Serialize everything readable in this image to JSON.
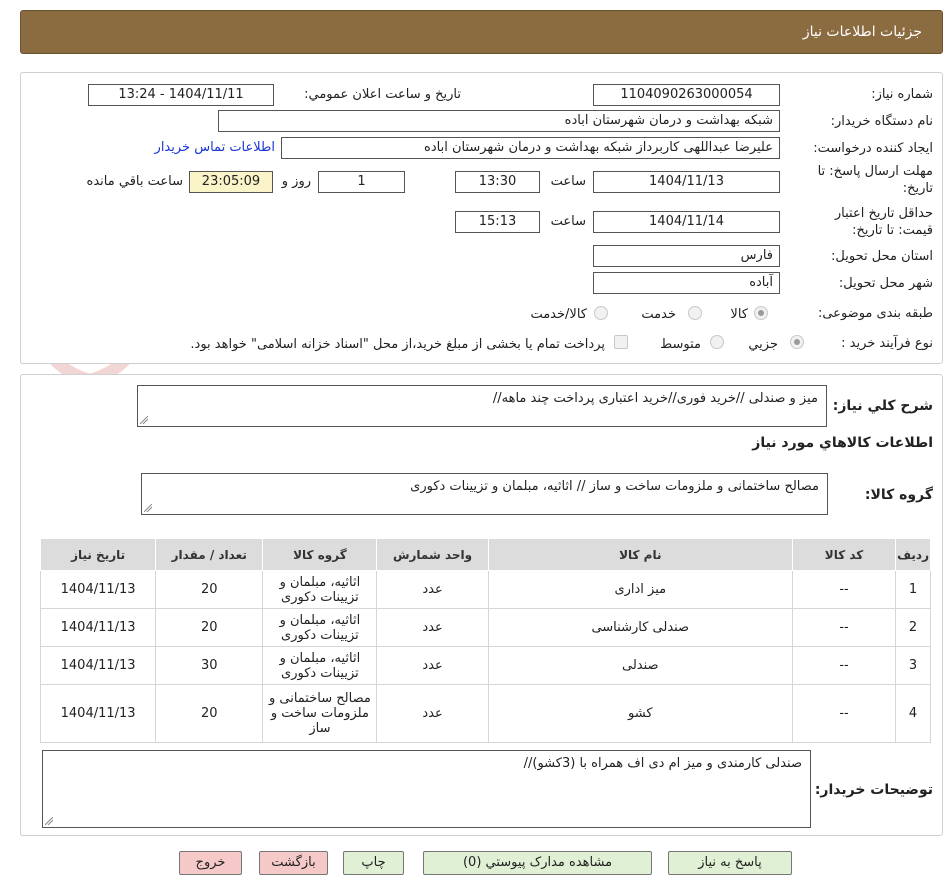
{
  "header": {
    "title": "جزئیات اطلاعات نیاز"
  },
  "watermark": {
    "text": "AriaTender.neT"
  },
  "form": {
    "need_number_label": "شماره نیاز:",
    "need_number": "1104090263000054",
    "announce_label": "تاریخ و ساعت اعلان عمومي:",
    "announce_value": "1404/11/11 - 13:24",
    "buyer_label": "نام دستگاه خريدار:",
    "buyer_value": "شبکه بهداشت و درمان شهرستان اباده",
    "creator_label": "ايجاد کننده درخواست:",
    "creator_value": "علیرضا عبداللهی کاربرداز شبکه بهداشت و درمان شهرستان اباده",
    "contact_link": "اطلاعات تماس خريدار",
    "deadline_label_1": "مهلت ارسال پاسخ: تا",
    "deadline_label_2": "تاريخ:",
    "deadline_date": "1404/11/13",
    "hour_label": "ساعت",
    "deadline_time": "13:30",
    "days_value": "1",
    "days_label": "روز و",
    "remaining_value": "23:05:09",
    "remaining_label": "ساعت باقي مانده",
    "validity_label_1": "حداقل تاريخ اعتبار",
    "validity_label_2": "قيمت: تا تاريخ:",
    "validity_date": "1404/11/14",
    "validity_time": "15:13",
    "province_label": "استان محل تحويل:",
    "province_value": "فارس",
    "city_label": "شهر محل تحويل:",
    "city_value": "آباده",
    "category_label": "طبقه بندی موضوعی:",
    "category_options": [
      "كالا",
      "خدمت",
      "كالا/خدمت"
    ],
    "process_label": "نوع فرآيند خريد :",
    "process_options": [
      "جزيي",
      "متوسط"
    ],
    "process_note": "پرداخت تمام يا بخشی از مبلغ خريد،از محل \"اسناد خزانه اسلامی\" خواهد بود."
  },
  "summary": {
    "label": "شرح كلي نياز:",
    "value": "میز و صندلی //خرید فوری//خرید اعتباری پرداخت چند ماهه//"
  },
  "goods": {
    "title": "اطلاعات كالاهاي مورد نياز",
    "group_label": "گروه كالا:",
    "group_value": "مصالح ساختمانی و ملزومات ساخت و ساز // اثاثیه، مبلمان و تزیینات دکوری"
  },
  "table": {
    "headers": [
      "رديف",
      "كد كالا",
      "نام كالا",
      "واحد شمارش",
      "گروه كالا",
      "تعداد / مقدار",
      "تاريخ نياز"
    ],
    "rows": [
      [
        "1",
        "--",
        "میز اداری",
        "عدد",
        "اثاثیه، مبلمان و تزیینات دکوری",
        "20",
        "1404/11/13"
      ],
      [
        "2",
        "--",
        "صندلی کارشناسی",
        "عدد",
        "اثاثیه، مبلمان و تزیینات دکوری",
        "20",
        "1404/11/13"
      ],
      [
        "3",
        "--",
        "صندلی",
        "عدد",
        "اثاثیه، مبلمان و تزیینات دکوری",
        "30",
        "1404/11/13"
      ],
      [
        "4",
        "--",
        "کشو",
        "عدد",
        "مصالح ساختمانی و ملزومات ساخت و ساز",
        "20",
        "1404/11/13"
      ]
    ]
  },
  "buyer_notes": {
    "label": "توضيحات خريدار:",
    "value": "صندلی کارمندی و میز ام دی اف همراه با (3کشو)//"
  },
  "buttons": {
    "reply": "پاسخ به نياز",
    "attachments": "مشاهده مدارک پيوستي (0)",
    "print": "چاپ",
    "back": "بازگشت",
    "exit": "خروج"
  },
  "colors": {
    "header_bg": "#8b6b40",
    "link": "#1a35d4",
    "remaining_bg": "#fbf4c9",
    "button_green": "#dff0d4",
    "button_pink": "#f6c9c9",
    "table_header_bg": "#dcdcdc"
  },
  "icons": [
    "shield-logo-icon",
    "resize-grip-icon"
  ]
}
